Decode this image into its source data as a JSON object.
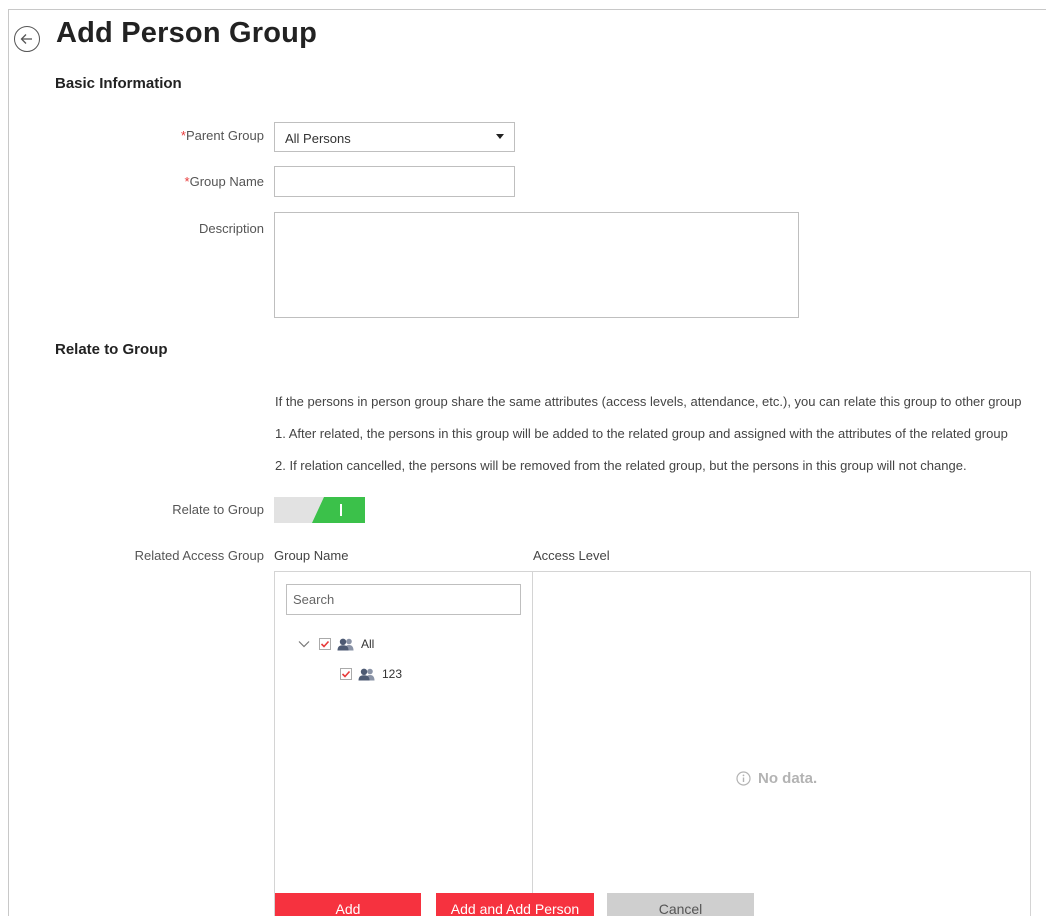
{
  "page": {
    "title": "Add Person Group"
  },
  "basic_information": {
    "section_title": "Basic Information",
    "parent_group": {
      "required_mark": "*",
      "label": "Parent Group",
      "value": "All Persons"
    },
    "group_name": {
      "required_mark": "*",
      "label": "Group Name",
      "value": ""
    },
    "description": {
      "label": "Description",
      "value": ""
    }
  },
  "relate_to_group": {
    "section_title": "Relate to Group",
    "info_lines": [
      "If the persons in person group share the same attributes (access levels, attendance, etc.), you can relate this group to other group",
      "1. After related, the persons in this group will be added to the related group and assigned with the attributes of the related group",
      "2. If relation cancelled, the persons will be removed from the related group, but the persons in this group will not change."
    ],
    "toggle": {
      "label": "Relate to Group",
      "state": "on",
      "on_color": "#3bc14a"
    },
    "related_access_group": {
      "label": "Related Access Group",
      "group_name_header": "Group Name",
      "access_level_header": "Access Level",
      "search_placeholder": "Search",
      "tree": [
        {
          "label": "All",
          "checked": true,
          "expanded": true,
          "icon": "group-icon"
        },
        {
          "label": "123",
          "checked": true,
          "icon": "group-icon"
        }
      ],
      "access_level_empty": "No data."
    }
  },
  "footer": {
    "add_label": "Add",
    "add_and_add_person_label": "Add and Add Person",
    "cancel_label": "Cancel",
    "primary_color": "#f6323f"
  }
}
